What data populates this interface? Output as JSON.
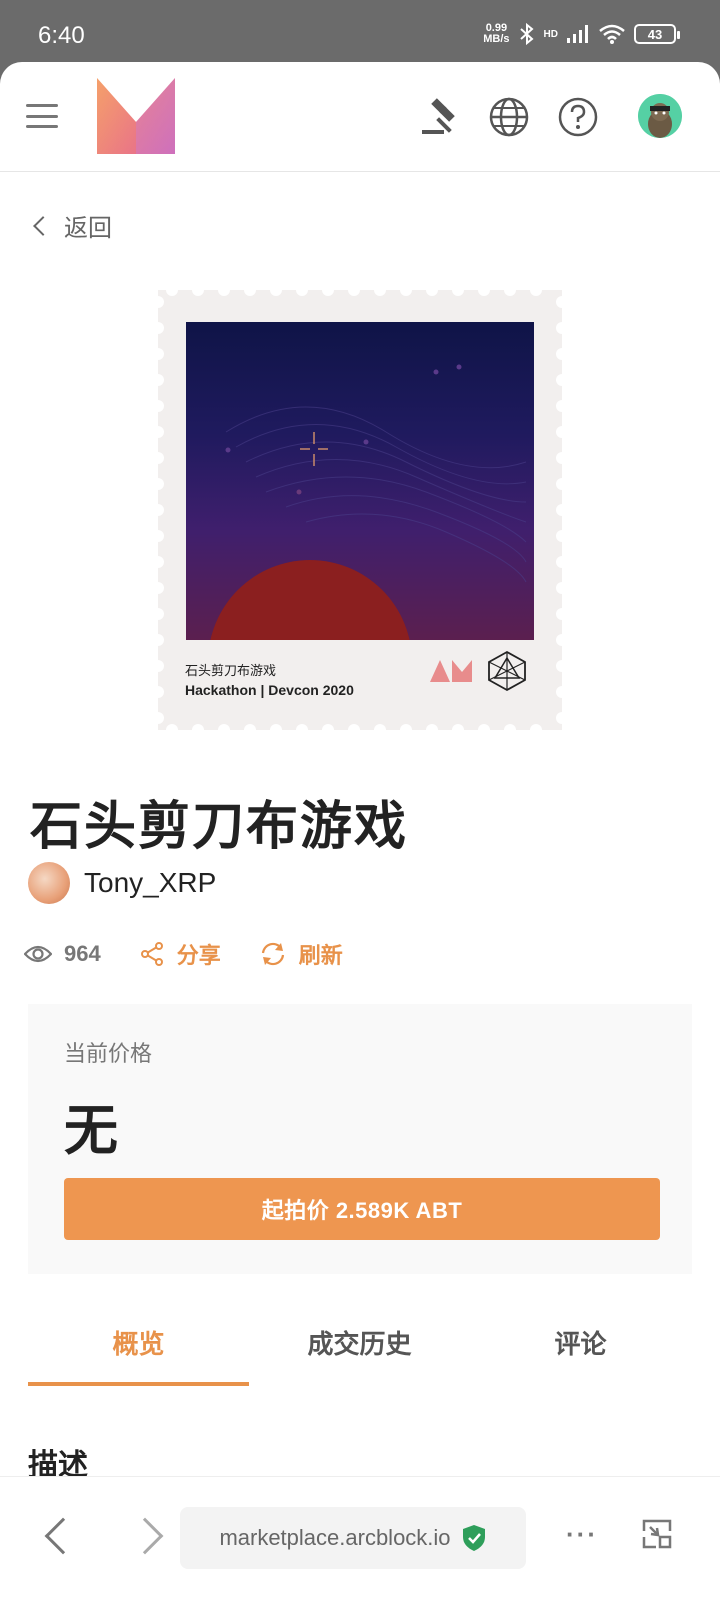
{
  "status": {
    "time": "6:40",
    "speed_value": "0.99",
    "speed_unit": "MB/s",
    "network": "HD",
    "battery": "43"
  },
  "header": {
    "logo": "logo-m",
    "icons": [
      "auction-hammer-icon",
      "globe-icon",
      "help-icon",
      "profile-avatar"
    ]
  },
  "back": {
    "label": "返回"
  },
  "stamp": {
    "caption1": "石头剪刀布游戏",
    "caption2": "Hackathon | Devcon 2020"
  },
  "item": {
    "title": "石头剪刀布游戏",
    "author": "Tony_XRP",
    "views": "964",
    "share_label": "分享",
    "refresh_label": "刷新"
  },
  "price": {
    "label": "当前价格",
    "value": "无",
    "button_label": "起拍价 2.589K ABT"
  },
  "tabs": [
    {
      "label": "概览",
      "active": true
    },
    {
      "label": "成交历史",
      "active": false
    },
    {
      "label": "评论",
      "active": false
    }
  ],
  "section": {
    "description_label": "描述"
  },
  "browser": {
    "url": "marketplace.arcblock.io",
    "more": "···"
  },
  "colors": {
    "accent": "#ee9650",
    "text": "#222222"
  }
}
